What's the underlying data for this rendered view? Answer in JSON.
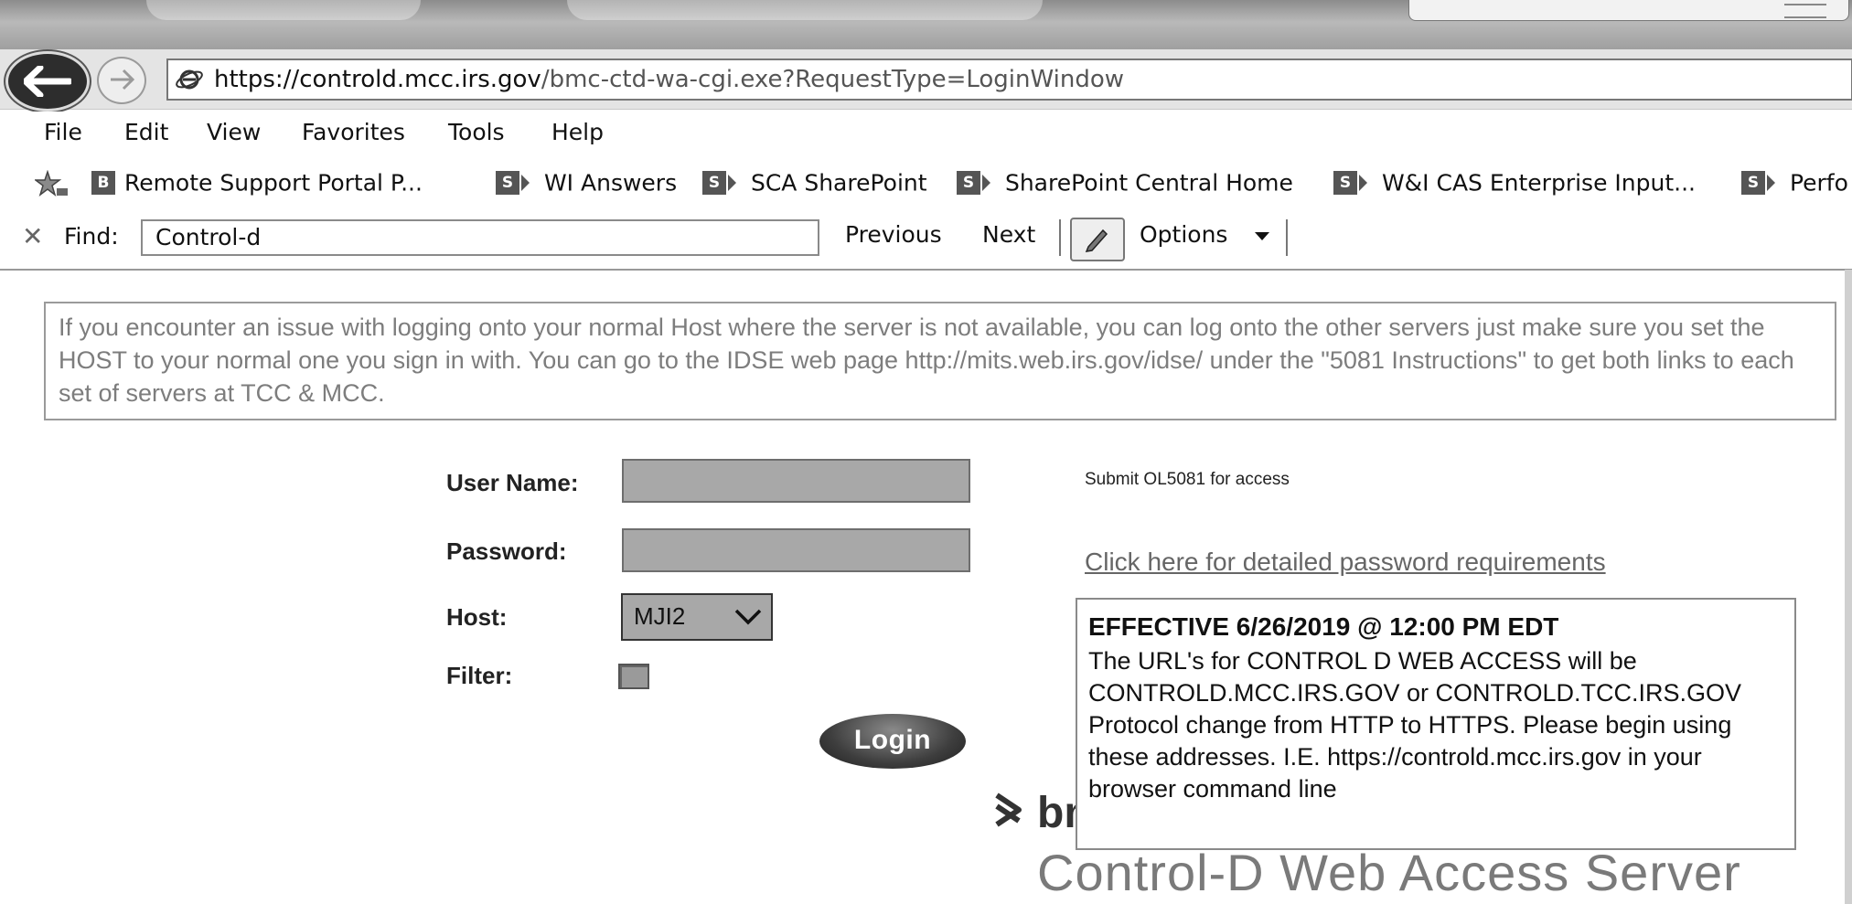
{
  "browser": {
    "url_protocol": "https://",
    "url_domain": "controld.mcc.irs.gov",
    "url_path": "/bmc-ctd-wa-cgi.exe?RequestType=LoginWindow",
    "menu": [
      "File",
      "Edit",
      "View",
      "Favorites",
      "Tools",
      "Help"
    ],
    "favorites": [
      {
        "badge": "B",
        "label": "Remote Support Portal  P..."
      },
      {
        "badge": "S",
        "label": "WI Answers"
      },
      {
        "badge": "S",
        "label": "SCA SharePoint"
      },
      {
        "badge": "S",
        "label": "SharePoint Central Home"
      },
      {
        "badge": "S",
        "label": "W&I CAS Enterprise Input..."
      },
      {
        "badge": "S",
        "label": "Perfo"
      }
    ],
    "find": {
      "close_glyph": "✕",
      "label": "Find:",
      "value": "Control-d",
      "previous": "Previous",
      "next": "Next",
      "options": "Options"
    }
  },
  "page": {
    "notice": "If you encounter an issue with logging onto your normal Host where the server is not available, you can log onto the other servers just make sure you set the HOST to your normal one you sign in with. You can go to the IDSE web page http://mits.web.irs.gov/idse/ under the \"5081 Instructions\" to get both links to each set of servers at TCC & MCC.",
    "form": {
      "username_label": "User Name:",
      "password_label": "Password:",
      "host_label": "Host:",
      "host_value": "MJI2",
      "filter_label": "Filter:",
      "login_label": "Login"
    },
    "submit_note": "Submit OL5081 for access",
    "password_link": "Click here for detailed password requirements",
    "effective": {
      "heading": "EFFECTIVE 6/26/2019 @ 12:00 PM EDT",
      "body": "The URL's for CONTROL D WEB ACCESS will be CONTROLD.MCC.IRS.GOV or CONTROLD.TCC.IRS.GOV Protocol change from HTTP to HTTPS. Please begin using these addresses. I.E. https://controld.mcc.irs.gov in your browser command line"
    },
    "brand_partial": "bmc",
    "product_title": "Control-D Web Access Server"
  },
  "colors": {
    "chrome_gray": "#e4e4e4",
    "input_fill": "#a8a8a8",
    "notice_text": "#7d7d7d"
  },
  "icons": [
    "back-arrow-icon",
    "forward-arrow-icon",
    "ie-logo-icon",
    "favorites-star-icon",
    "sharepoint-icon",
    "close-icon",
    "pencil-icon",
    "chevron-down-icon",
    "bmc-chevron-icon"
  ]
}
